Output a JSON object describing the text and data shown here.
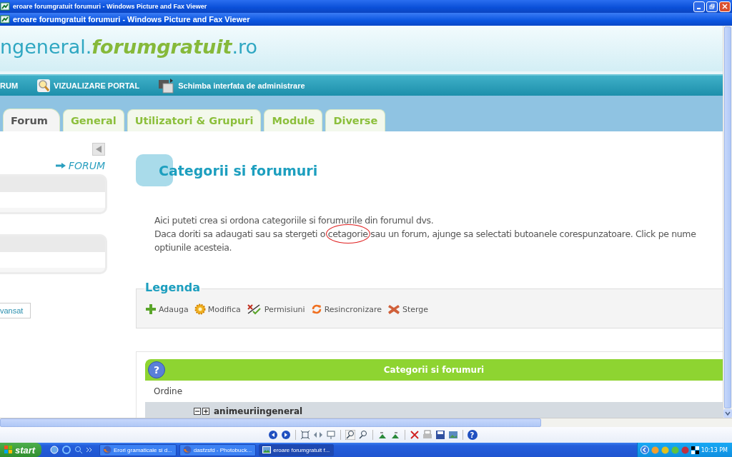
{
  "outer_window": {
    "title": "eroare forumgratuit forumuri - Windows Picture and Fax Viewer"
  },
  "viewer_window": {
    "title": "eroare forumgratuit forumuri - Windows Picture and Fax Viewer"
  },
  "site": {
    "logo": [
      {
        "text": "ngeneral.",
        "kind": "plain"
      },
      {
        "text": "forumgratuit",
        "kind": "accent"
      },
      {
        "text": ".ro",
        "kind": "plain"
      }
    ]
  },
  "nav": [
    {
      "label": "RUM",
      "kind": "text"
    },
    {
      "label": "VIZUALIZARE PORTAL",
      "kind": "magnifier"
    },
    {
      "label": "Schimba interfata de administrare",
      "kind": "screens"
    }
  ],
  "tabs": [
    {
      "label": "Forum",
      "selected": true
    },
    {
      "label": "General",
      "selected": false
    },
    {
      "label": "Utilizatori & Grupuri",
      "selected": false
    },
    {
      "label": "Module",
      "selected": false
    },
    {
      "label": "Diverse",
      "selected": false
    }
  ],
  "sidebar": {
    "section_link": "FORUM",
    "button": "vansat"
  },
  "content": {
    "title": "Categorii si forumuri",
    "paragraph_lines": [
      [
        {
          "text": "Aici puteti crea si ordona categoriile si forumurile din forumul dvs.",
          "circled": false
        }
      ],
      [
        {
          "text": "Daca doriti sa adaugati sau sa stergeti o ",
          "circled": false
        },
        {
          "text": "cetagorie",
          "circled": true
        },
        {
          "text": " sau un forum, ajunge sa selectati butoanele corespunzatoare. Click pe nume",
          "circled": false
        }
      ],
      [
        {
          "text": "optiunile acesteia.",
          "circled": false
        }
      ]
    ]
  },
  "legend": {
    "title": "Legenda",
    "items": [
      {
        "label": "Adauga",
        "kind": "add"
      },
      {
        "label": "Modifica",
        "kind": "edit"
      },
      {
        "label": "Permisiuni",
        "kind": "permissions"
      },
      {
        "label": "Resincronizare",
        "kind": "resync"
      },
      {
        "label": "Sterge",
        "kind": "delete"
      }
    ]
  },
  "table": {
    "help_icon": "?",
    "title": "Categorii si forumuri",
    "column_1": "Ordine",
    "rows": [
      {
        "name": "animeuriingeneral"
      }
    ]
  },
  "viewer_toolbar": {
    "help_icon": "?"
  },
  "taskbar": {
    "start": "start",
    "tasks": [
      {
        "label": "Erori gramaticale si d...",
        "kind": "browser",
        "selected": false
      },
      {
        "label": "dasfzsfd - Photobuck...",
        "kind": "browser",
        "selected": false
      },
      {
        "label": "eroare forumgratuit f...",
        "kind": "viewer",
        "selected": true
      }
    ],
    "clock": "10:13 PM"
  }
}
